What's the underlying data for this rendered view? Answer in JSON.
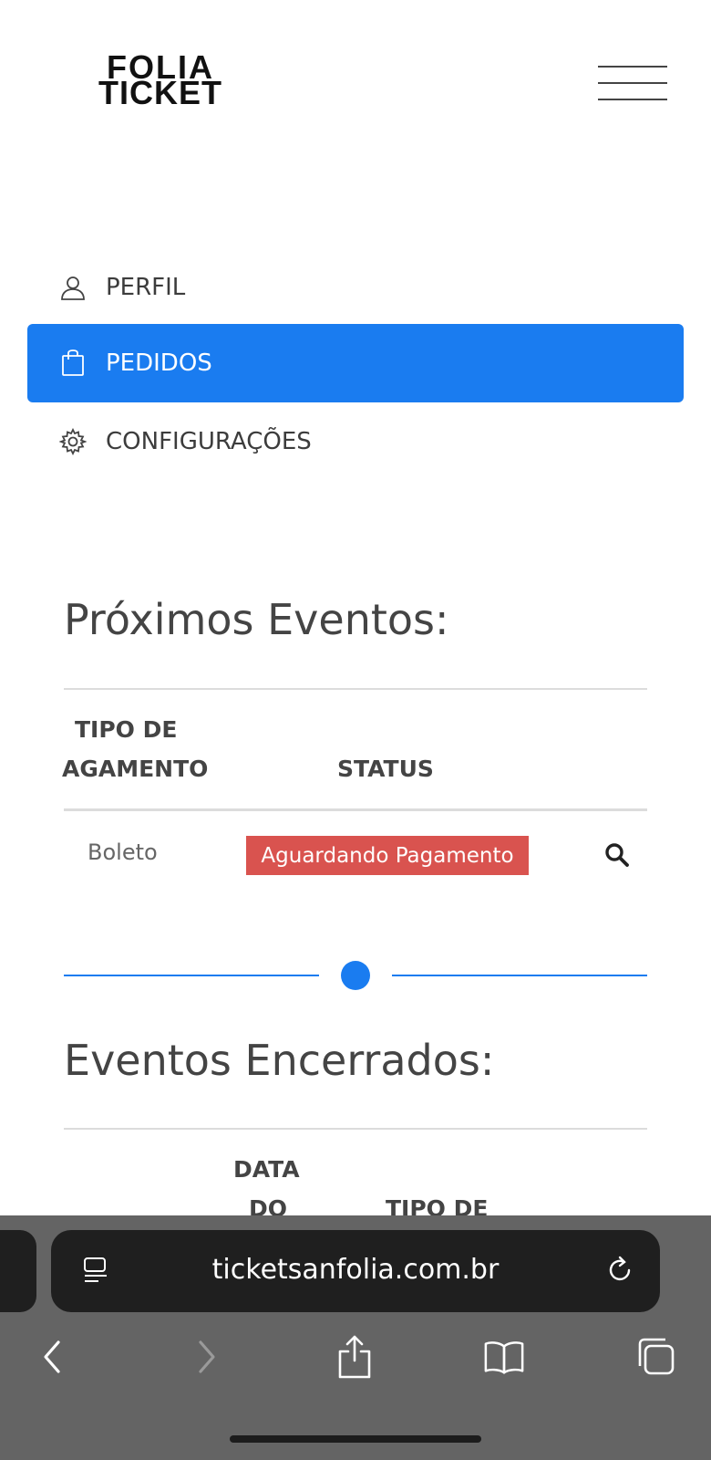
{
  "header": {
    "logo_line1": "FOLIA",
    "logo_line2": "TICKET"
  },
  "menu": {
    "items": [
      {
        "label": "PERFIL",
        "icon": "user-icon",
        "active": false
      },
      {
        "label": "PEDIDOS",
        "icon": "shopping-bag-icon",
        "active": true
      },
      {
        "label": "CONFIGURAÇÕES",
        "icon": "gear-icon",
        "active": false
      }
    ]
  },
  "upcoming": {
    "title": "Próximos Eventos:",
    "columns": [
      "TIPO DE",
      "AGAMENTO",
      "STATUS"
    ],
    "rows": [
      {
        "payment_type": "Boleto",
        "status": "Aguardando Pagamento",
        "action_icon": "search-icon"
      }
    ]
  },
  "closed": {
    "title": "Eventos Encerrados:",
    "columns": [
      "DATA",
      "DO",
      "TIPO DE"
    ]
  },
  "browser": {
    "url": "ticketsanfolia.com.br"
  },
  "colors": {
    "accent": "#1a7cf0",
    "status_pending": "#d9534f",
    "browser_bar": "#646464"
  }
}
